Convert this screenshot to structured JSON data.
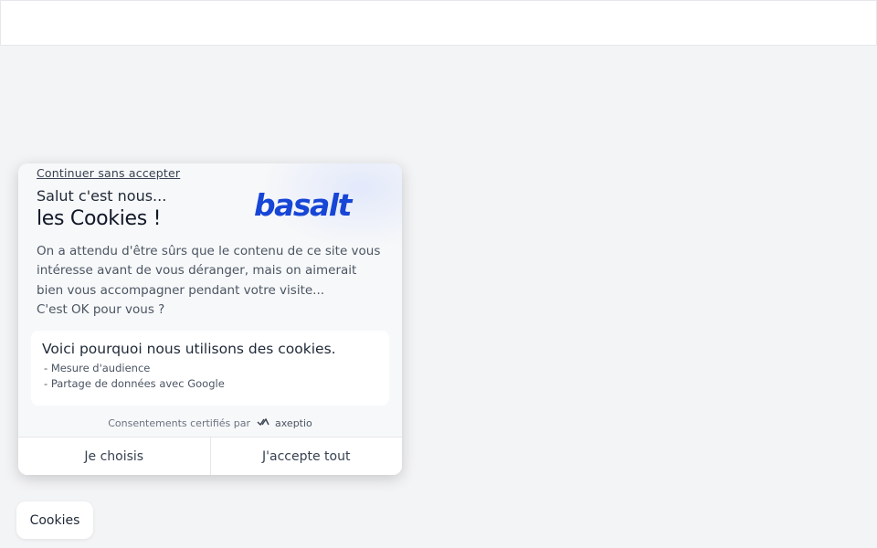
{
  "consent": {
    "continue_label": "Continuer sans accepter",
    "greeting": "Salut c'est nous...",
    "headline": "les Cookies !",
    "logo_text": "basalt",
    "intro_lines": [
      "On a attendu d'être sûrs que le contenu de ce site vous intéresse avant de vous déranger, mais on aimerait bien vous accompagner pendant votre visite...",
      "C'est OK pour vous ?"
    ],
    "reasons_title": "Voici pourquoi nous utilisons des cookies.",
    "reasons": [
      "Mesure d'audience",
      "Partage de données avec Google"
    ],
    "certified_text": "Consentements certifiés par",
    "certified_brand": "axeptio",
    "choose_label": "Je choisis",
    "accept_label": "J'accepte tout"
  },
  "cookies_button_label": "Cookies",
  "colors": {
    "brand_blue": "#1746d6",
    "background": "#f3f4f6",
    "card": "#f7f8f9"
  }
}
